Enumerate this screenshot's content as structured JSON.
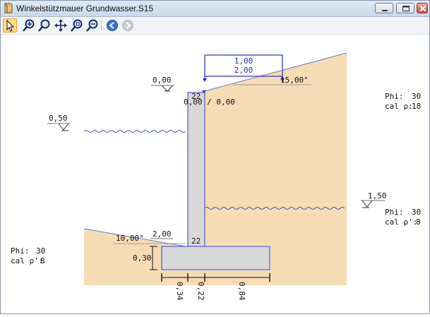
{
  "window": {
    "title": "Winkelstützmauer Grundwasser.S15"
  },
  "toolbar": {
    "buttons": [
      {
        "name": "select-tool-button",
        "icon": "cursor-icon"
      },
      {
        "name": "zoom-in-button",
        "icon": "zoom-in-icon"
      },
      {
        "name": "zoom-window-button",
        "icon": "zoom-window-icon"
      },
      {
        "name": "pan-button",
        "icon": "pan-icon"
      },
      {
        "name": "zoom-fit-button",
        "icon": "zoom-fit-icon"
      },
      {
        "name": "zoom-out-button",
        "icon": "zoom-out-icon"
      },
      {
        "name": "back-button",
        "icon": "back-arrow-icon"
      },
      {
        "name": "forward-button",
        "icon": "forward-arrow-icon"
      }
    ]
  },
  "drawing": {
    "load_top": "1,00",
    "load_bottom": "2,00",
    "slope_right": "15,00°",
    "ground_level_label": "0,00",
    "wall_top_label": "0,00 / 0,00",
    "wall_top_thickness": "22",
    "water_level_left": "0,50",
    "water_level_right": "1,50",
    "soil_right_upper": {
      "phi_label": "Phi:",
      "phi_value": "30",
      "gamma_label": "cal ρ:",
      "gamma_value": "18"
    },
    "soil_right_lower": {
      "phi_label": "Phi:",
      "phi_value": "30",
      "gamma_label": "cal ρ':",
      "gamma_value": "8"
    },
    "soil_left": {
      "phi_label": "Phi:",
      "phi_value": "30",
      "gamma_label": "cal ρ':",
      "gamma_value": "8"
    },
    "slope_left": "10,00°",
    "front_height": "2,00",
    "wall_bottom_thickness": "22",
    "footing_height": "0,30",
    "dim_toe": "0,34",
    "dim_stem": "0,22",
    "dim_heel": "0,84"
  },
  "colors": {
    "soil": "#f5dcb5",
    "wall": "#d8d8d8",
    "outline": "#3a3acc",
    "water": "#4a56b8"
  }
}
